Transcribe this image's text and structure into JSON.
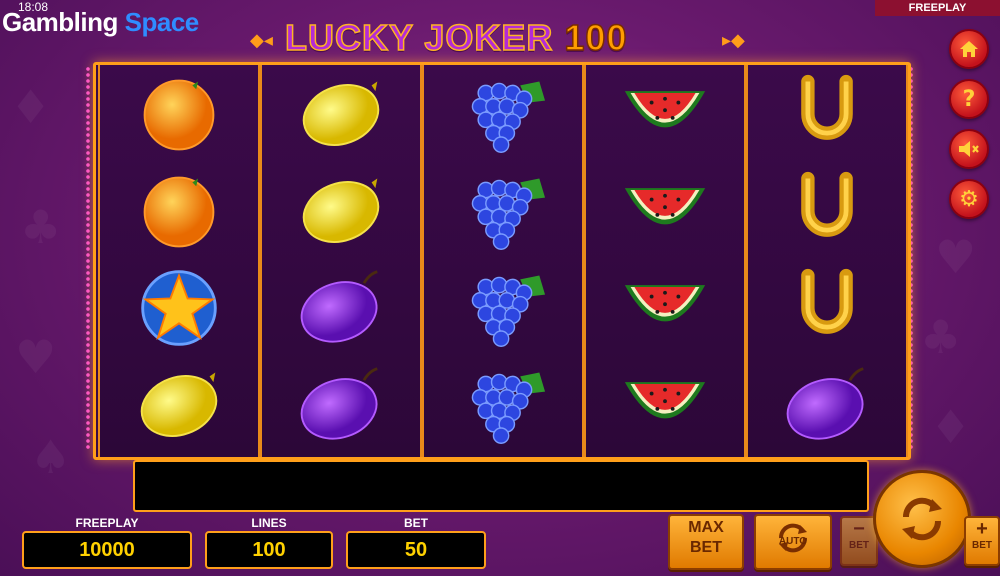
{
  "status": {
    "time": "18:08"
  },
  "brand": {
    "word1": "Gambling",
    "word2": "Space"
  },
  "title": {
    "main": "LUCKY JOKER",
    "number": "100"
  },
  "mode_tag": "FREEPLAY",
  "side_buttons": [
    {
      "name": "home-button",
      "icon": "home-icon"
    },
    {
      "name": "help-button",
      "icon": "question-icon",
      "glyph": "?"
    },
    {
      "name": "sound-button",
      "icon": "sound-muted-icon"
    },
    {
      "name": "settings-button",
      "icon": "gear-icon",
      "glyph": "⚙"
    }
  ],
  "reels": [
    [
      "orange",
      "orange",
      "star",
      "lemon"
    ],
    [
      "lemon",
      "lemon",
      "plum",
      "plum"
    ],
    [
      "grapes",
      "grapes",
      "grapes",
      "grapes"
    ],
    [
      "watermelon",
      "watermelon",
      "watermelon",
      "watermelon"
    ],
    [
      "horseshoe",
      "horseshoe",
      "horseshoe",
      "plum"
    ]
  ],
  "stats": {
    "freeplay_label": "FREEPLAY",
    "freeplay_value": "10000",
    "lines_label": "LINES",
    "lines_value": "100",
    "bet_label": "BET",
    "bet_value": "50"
  },
  "controls": {
    "max_bet_top": "MAX",
    "max_bet_bottom": "BET",
    "auto_label": "AUTO",
    "bet_minus_sign": "−",
    "bet_minus_label": "BET",
    "bet_plus_sign": "+",
    "bet_plus_label": "BET"
  },
  "colors": {
    "accent": "#ff9f1a",
    "stat_value": "#ffd100",
    "side_button": "#c3121c"
  }
}
